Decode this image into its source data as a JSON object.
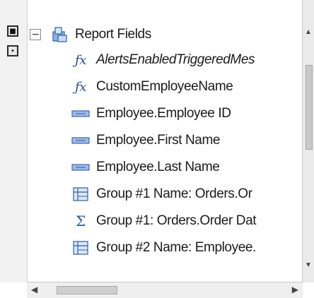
{
  "tree": {
    "root": {
      "label": "Report Fields",
      "expander": "−"
    },
    "items": [
      {
        "icon": "formula-icon",
        "label": "AlertsEnabledTriggeredMes"
      },
      {
        "icon": "formula-icon",
        "label": "CustomEmployeeName"
      },
      {
        "icon": "database-field-icon",
        "label": "Employee.Employee ID"
      },
      {
        "icon": "database-field-icon",
        "label": "Employee.First Name"
      },
      {
        "icon": "database-field-icon",
        "label": "Employee.Last Name"
      },
      {
        "icon": "group-name-icon",
        "label": "Group #1 Name: Orders.Or"
      },
      {
        "icon": "summary-icon",
        "label": "Group #1: Orders.Order Dat"
      },
      {
        "icon": "group-name-icon",
        "label": "Group #2 Name: Employee."
      }
    ]
  },
  "colors": {
    "formula": "#2a4a8c",
    "field": "#3c66b8",
    "group": "#2f5fa8",
    "text": "#1b1b1b"
  }
}
